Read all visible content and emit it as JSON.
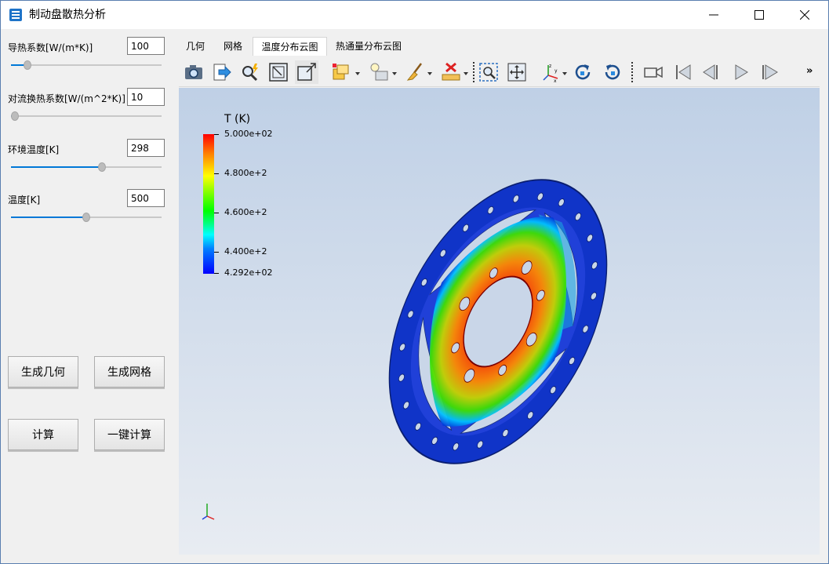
{
  "window": {
    "title": "制动盘散热分析",
    "minimize_icon": "minimize-icon",
    "maximize_icon": "maximize-icon",
    "close_icon": "close-icon"
  },
  "params": [
    {
      "label": "导热系数[W/(m*K)]",
      "value": "100",
      "slider_fraction": 0.09
    },
    {
      "label": "对流换热系数[W/(m^2*K)]",
      "value": "10",
      "slider_fraction": 0.0
    },
    {
      "label": "环境温度[K]",
      "value": "298",
      "slider_fraction": 0.61
    },
    {
      "label": "温度[K]",
      "value": "500",
      "slider_fraction": 0.5
    }
  ],
  "buttons": {
    "gen_geometry": "生成几何",
    "gen_mesh": "生成网格",
    "compute": "计算",
    "one_click": "一键计算"
  },
  "tabs": [
    {
      "label": "几何",
      "active": false
    },
    {
      "label": "网格",
      "active": false
    },
    {
      "label": "温度分布云图",
      "active": true
    },
    {
      "label": "热通量分布云图",
      "active": false
    }
  ],
  "toolbar": {
    "icons": [
      "camera-icon",
      "export-icon",
      "pick-icon",
      "zoom-box-icon",
      "resize-icon",
      "display-mode-icon",
      "light-icon",
      "brush-icon",
      "ruler-icon",
      "zoom-fit-icon",
      "pan-icon",
      "axes-icon",
      "rotate-cw-icon",
      "rotate-ccw-icon",
      "video-camera-icon",
      "first-frame-icon",
      "prev-frame-icon",
      "play-icon",
      "last-frame-icon"
    ],
    "more": "»"
  },
  "legend": {
    "title": "T (K)",
    "max": "5.000e+02",
    "ticks": [
      "4.800e+2",
      "4.600e+2",
      "4.400e+2"
    ],
    "min": "4.292e+02"
  },
  "colors": {
    "accent": "#0078d7",
    "hot": "#ff0000",
    "cold": "#0000ff"
  }
}
